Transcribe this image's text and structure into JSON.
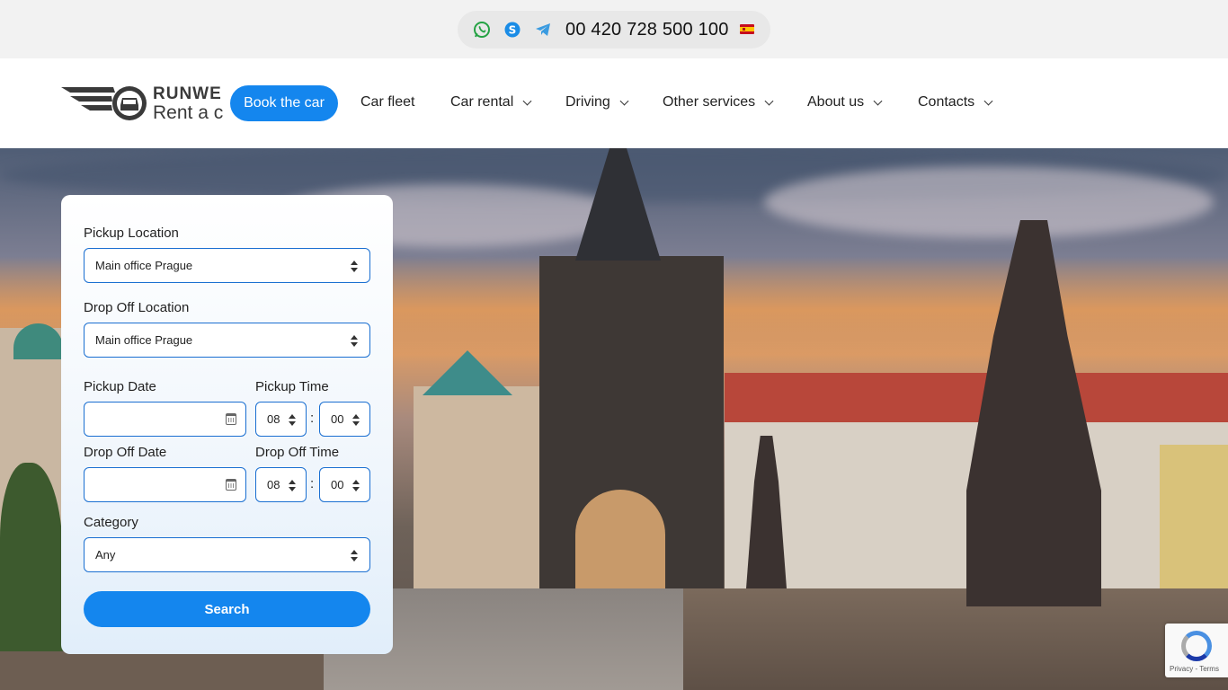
{
  "topbar": {
    "phone": "00 420 728 500 100",
    "icons": [
      "whatsapp-icon",
      "skype-icon",
      "telegram-icon",
      "spain-flag-icon"
    ]
  },
  "header": {
    "logo_line1": "RUNWE",
    "logo_line2": "Rent a c",
    "book_button": "Book the car",
    "nav": [
      {
        "label": "Car fleet",
        "has_dropdown": false
      },
      {
        "label": "Car rental",
        "has_dropdown": true
      },
      {
        "label": "Driving",
        "has_dropdown": true
      },
      {
        "label": "Other services",
        "has_dropdown": true
      },
      {
        "label": "About us",
        "has_dropdown": true
      },
      {
        "label": "Contacts",
        "has_dropdown": true
      }
    ]
  },
  "form": {
    "pickup_location_label": "Pickup Location",
    "pickup_location_value": "Main office Prague",
    "dropoff_location_label": "Drop Off Location",
    "dropoff_location_value": "Main office Prague",
    "pickup_date_label": "Pickup Date",
    "pickup_date_value": "",
    "pickup_time_label": "Pickup Time",
    "pickup_hour": "08",
    "pickup_minute": "00",
    "dropoff_date_label": "Drop Off Date",
    "dropoff_date_value": "",
    "dropoff_time_label": "Drop Off Time",
    "dropoff_hour": "08",
    "dropoff_minute": "00",
    "time_separator": ":",
    "category_label": "Category",
    "category_value": "Any",
    "search_button": "Search"
  },
  "recaptcha": {
    "text": "Privacy - Terms"
  },
  "colors": {
    "accent": "#1486ee",
    "field_border": "#1a6fd1"
  }
}
